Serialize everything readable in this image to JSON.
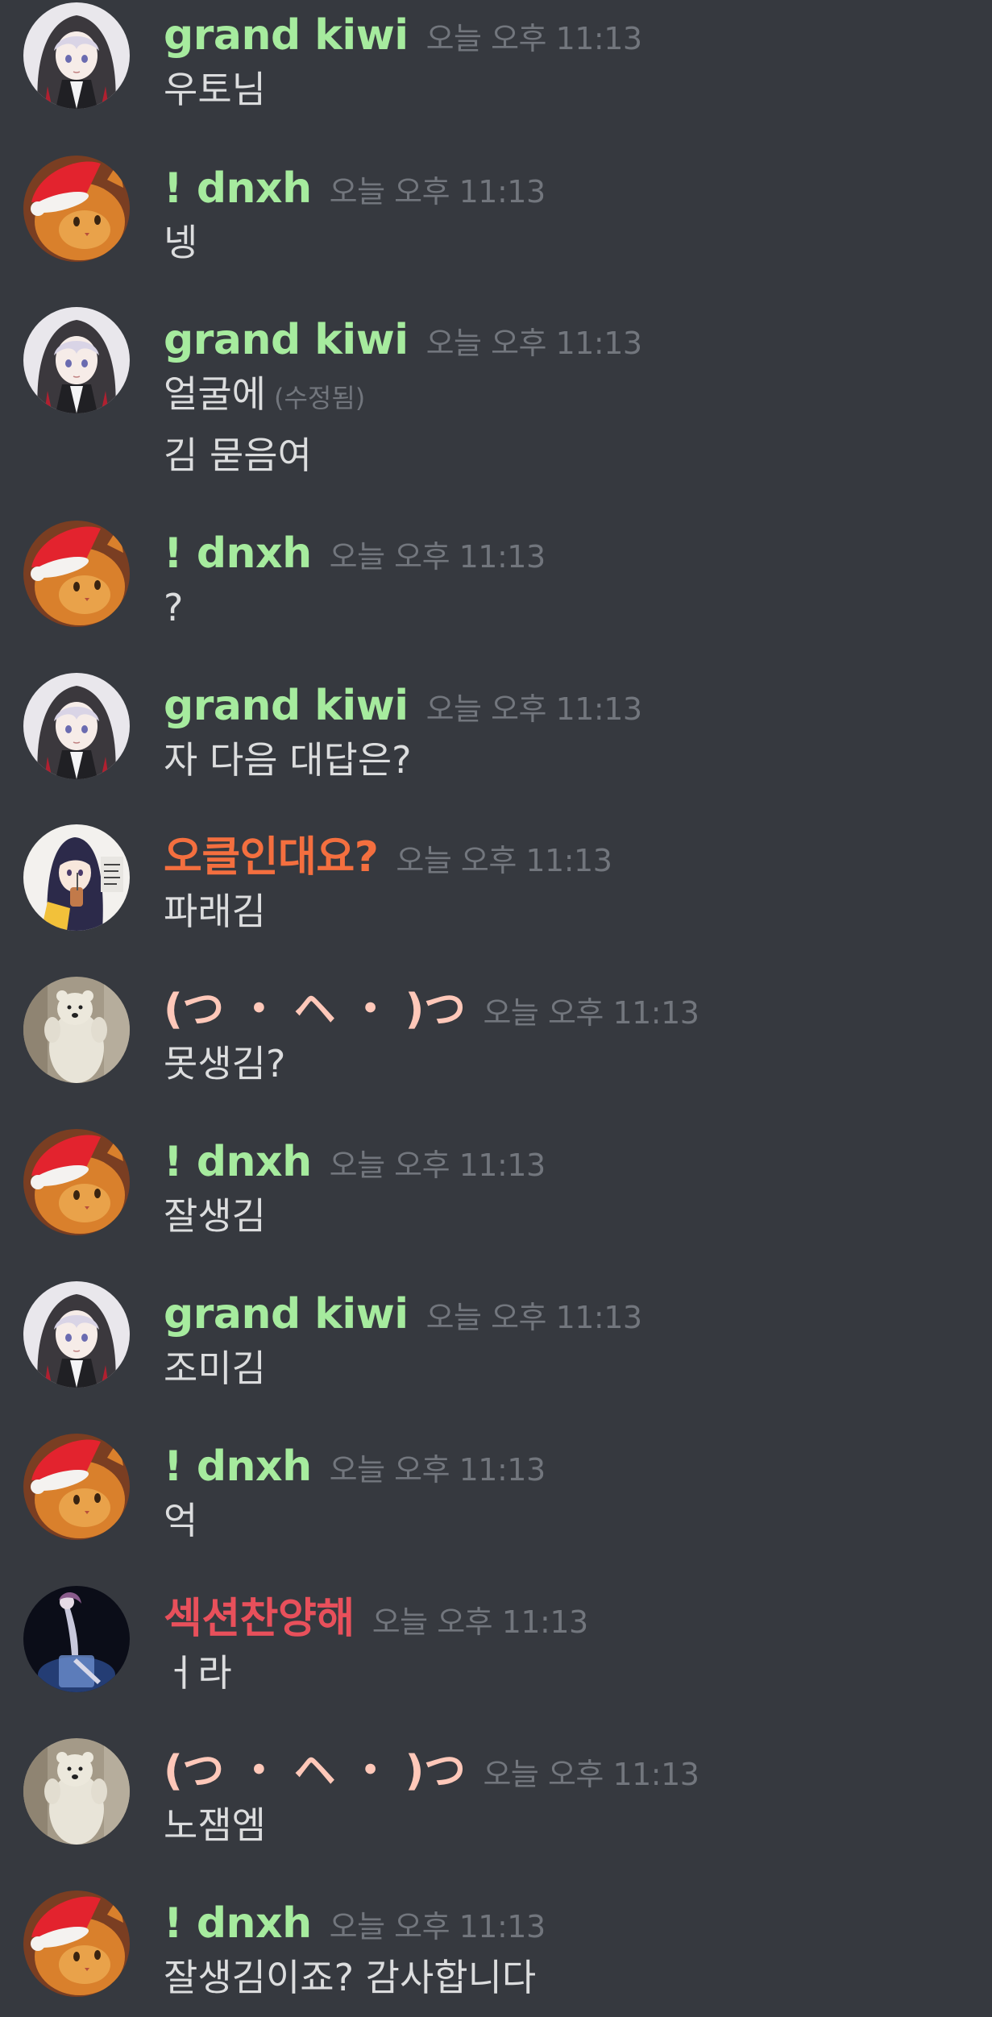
{
  "colors": {
    "background": "#36393f",
    "text": "#dcddde",
    "muted": "#72767d"
  },
  "messages": [
    {
      "user": "grand kiwi",
      "user_color": "#a6eb9e",
      "avatar": "hooded-anime-girl-avatar",
      "time": "오늘 오후 11:13",
      "lines": [
        "우토님"
      ]
    },
    {
      "user": "! dnxh",
      "user_color": "#a6eb9e",
      "avatar": "santa-hat-cat-avatar",
      "time": "오늘 오후 11:13",
      "lines": [
        "넹"
      ]
    },
    {
      "user": "grand kiwi",
      "user_color": "#a6eb9e",
      "avatar": "hooded-anime-girl-avatar",
      "time": "오늘 오후 11:13",
      "lines": [
        "얼굴에",
        "김 묻음여"
      ],
      "edited": "(수정됨)"
    },
    {
      "user": "! dnxh",
      "user_color": "#a6eb9e",
      "avatar": "santa-hat-cat-avatar",
      "time": "오늘 오후 11:13",
      "lines": [
        "?"
      ]
    },
    {
      "user": "grand kiwi",
      "user_color": "#a6eb9e",
      "avatar": "hooded-anime-girl-avatar",
      "time": "오늘 오후 11:13",
      "lines": [
        "자 다음 대답은?"
      ]
    },
    {
      "user": "오클인대요?",
      "user_color": "#f46f3f",
      "avatar": "anime-girl-drinking-avatar",
      "time": "오늘 오후 11:13",
      "lines": [
        "파래김"
      ]
    },
    {
      "user": "(つ ・ ヘ ・ )つ",
      "user_color": "#ffc8b9",
      "avatar": "polar-bear-avatar",
      "time": "오늘 오후 11:13",
      "lines": [
        "못생김?"
      ]
    },
    {
      "user": "! dnxh",
      "user_color": "#a6eb9e",
      "avatar": "santa-hat-cat-avatar",
      "time": "오늘 오후 11:13",
      "lines": [
        "잘생김"
      ]
    },
    {
      "user": "grand kiwi",
      "user_color": "#a6eb9e",
      "avatar": "hooded-anime-girl-avatar",
      "time": "오늘 오후 11:13",
      "lines": [
        "조미김"
      ]
    },
    {
      "user": "! dnxh",
      "user_color": "#a6eb9e",
      "avatar": "santa-hat-cat-avatar",
      "time": "오늘 오후 11:13",
      "lines": [
        "억"
      ]
    },
    {
      "user": "섹션찬양해",
      "user_color": "#e8505b",
      "avatar": "dark-anime-figure-avatar",
      "time": "오늘 오후 11:13",
      "lines": [
        "ㅓ라"
      ]
    },
    {
      "user": "(つ ・ ヘ ・ )つ",
      "user_color": "#ffc8b9",
      "avatar": "polar-bear-avatar",
      "time": "오늘 오후 11:13",
      "lines": [
        "노잼엠"
      ]
    },
    {
      "user": "! dnxh",
      "user_color": "#a6eb9e",
      "avatar": "santa-hat-cat-avatar",
      "time": "오늘 오후 11:13",
      "lines": [
        "잘생김이죠? 감사합니다"
      ]
    }
  ]
}
